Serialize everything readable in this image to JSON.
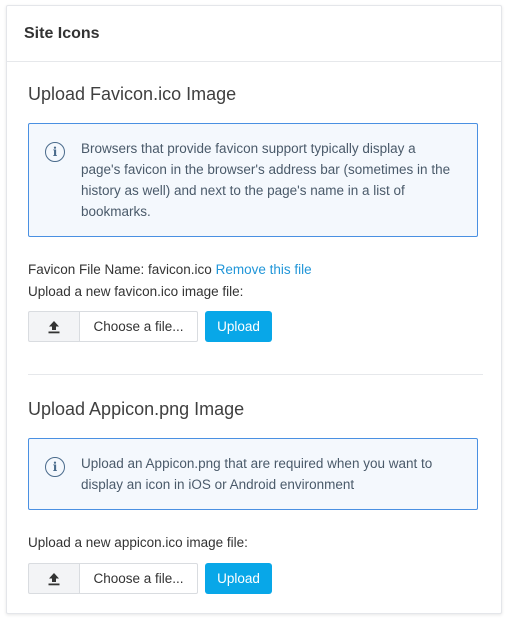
{
  "card": {
    "title": "Site Icons"
  },
  "favicon": {
    "section_title": "Upload Favicon.ico Image",
    "info_lines": [
      "Browsers that provide favicon support typically display a",
      "page's favicon in the browser's address bar (sometimes in the",
      "history as well) and next to the page's name in a list of",
      "bookmarks."
    ],
    "file_name_label": "Favicon File Name: favicon.ico",
    "remove_link": "Remove this file",
    "upload_prompt": "Upload a new favicon.ico image file:",
    "choose_label": "Choose a file...",
    "upload_label": "Upload"
  },
  "appicon": {
    "section_title": "Upload Appicon.png Image",
    "info_lines": [
      "Upload an Appicon.png that are required when you want to",
      "display an icon in iOS or Android environment"
    ],
    "upload_prompt": "Upload a new appicon.ico image file:",
    "choose_label": "Choose a file...",
    "upload_label": "Upload"
  },
  "colors": {
    "accent": "#08a7e8",
    "link": "#2196d8",
    "info_border": "#4a90e2",
    "info_background": "#f4f8fd"
  },
  "icons": {
    "info": "info-circle-icon",
    "upload": "upload-arrow-icon"
  }
}
